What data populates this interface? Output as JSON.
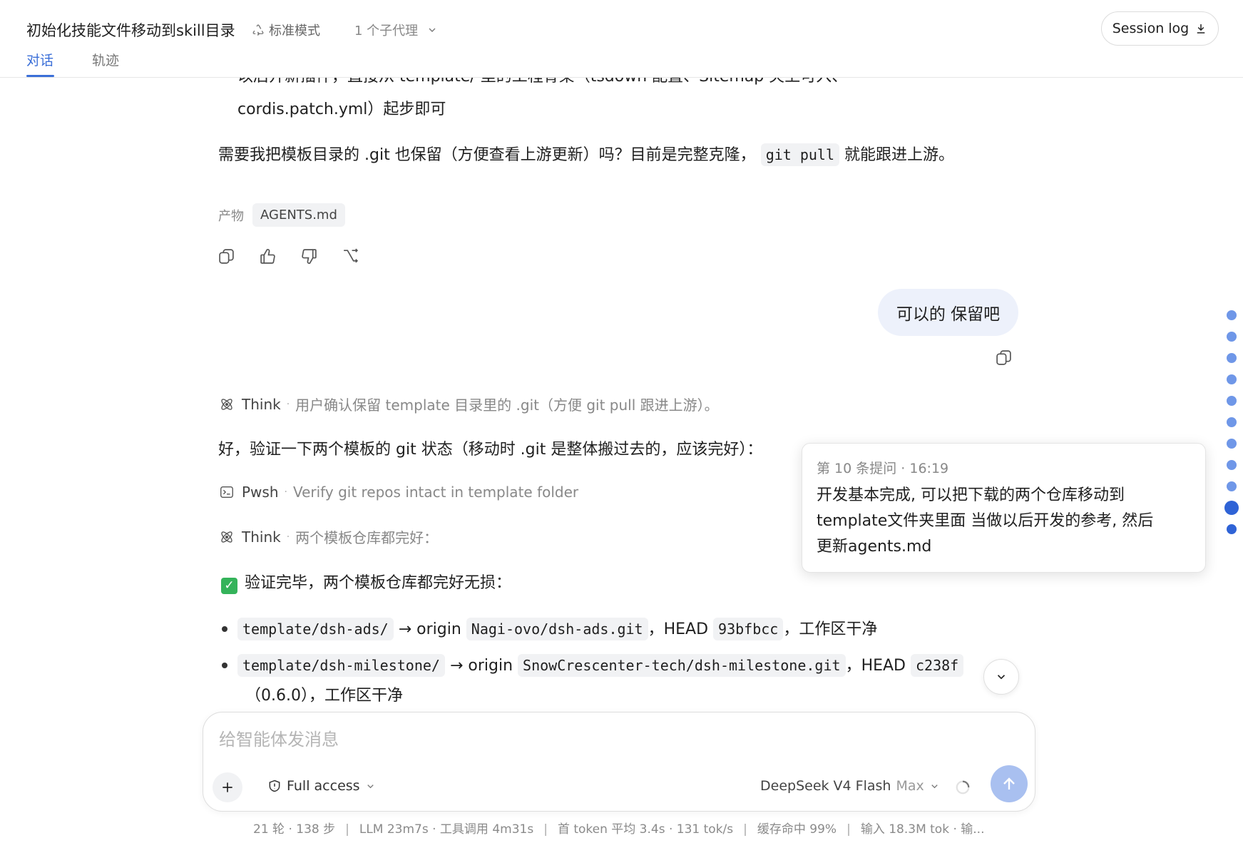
{
  "header": {
    "title": "初始化技能文件移动到skill目录",
    "mode": "标准模式",
    "subagents": "1 个子代理",
    "session_log": "Session log",
    "tabs": [
      {
        "label": "对话"
      },
      {
        "label": "轨迹"
      }
    ]
  },
  "messages": {
    "partial_line_1": "以后开新插件，直接从 template/ 里的工程骨架（tsdown 配置、Sitemap 夹上可入、",
    "partial_line_2": "cordis.patch.yml）起步即可",
    "question_pre": "需要我把模板目录的 .git 也保留（方便查看上游更新）吗？目前是完整克隆，",
    "question_code": "git pull",
    "question_post": "就能跟进上游。",
    "artifacts_label": "产物",
    "artifact_chip": "AGENTS.md",
    "user_message": "可以的 保留吧",
    "think1_name": "Think",
    "think1_desc": "用户确认保留 template 目录里的 .git（方便 git pull 跟进上游）。",
    "reply1": "好，验证一下两个模板的 git 状态（移动时 .git 是整体搬过去的，应该完好）：",
    "pwsh_name": "Pwsh",
    "pwsh_desc": "Verify git repos intact in template folder",
    "think2_name": "Think",
    "think2_desc": "两个模板仓库都完好：",
    "verified": "验证完毕，两个模板仓库都完好无损：",
    "bullets": [
      {
        "path": "template/dsh-ads/",
        "arrow_origin": "→ origin",
        "repo": "Nagi-ovo/dsh-ads.git",
        "head_label": "，HEAD",
        "hash": "93bfbcc",
        "tail": "，工作区干净"
      },
      {
        "path": "template/dsh-milestone/",
        "arrow_origin": "→ origin",
        "repo": "SnowCrescenter-tech/dsh-milestone.git",
        "head_label": "，HEAD",
        "hash": "c238f",
        "tail": "（0.6.0），工作区干净"
      }
    ]
  },
  "tooltip": {
    "head": "第 10 条提问 · 16:19",
    "body_line1": "开发基本完成, 可以把下载的两个仓库移动到",
    "body_line2": "template文件夹里面 当做以后开发的参考, 然后",
    "body_line3": "更新agents.md"
  },
  "composer": {
    "placeholder": "给智能体发消息",
    "access": "Full access",
    "model": "DeepSeek V4 Flash",
    "model_tier": "Max"
  },
  "stats": {
    "turns": "21 轮 · 138 步",
    "llm": "LLM 23m7s · 工具调用 4m31s",
    "first_token": "首 token 平均 3.4s · 131 tok/s",
    "cache": "缓存命中 99%",
    "input": "输入 18.3M tok · 输..."
  },
  "colors": {
    "accent": "#3b6fd8",
    "send_button": "#a9c0f0",
    "user_bubble": "#edf1fb",
    "check": "#34b35a"
  }
}
